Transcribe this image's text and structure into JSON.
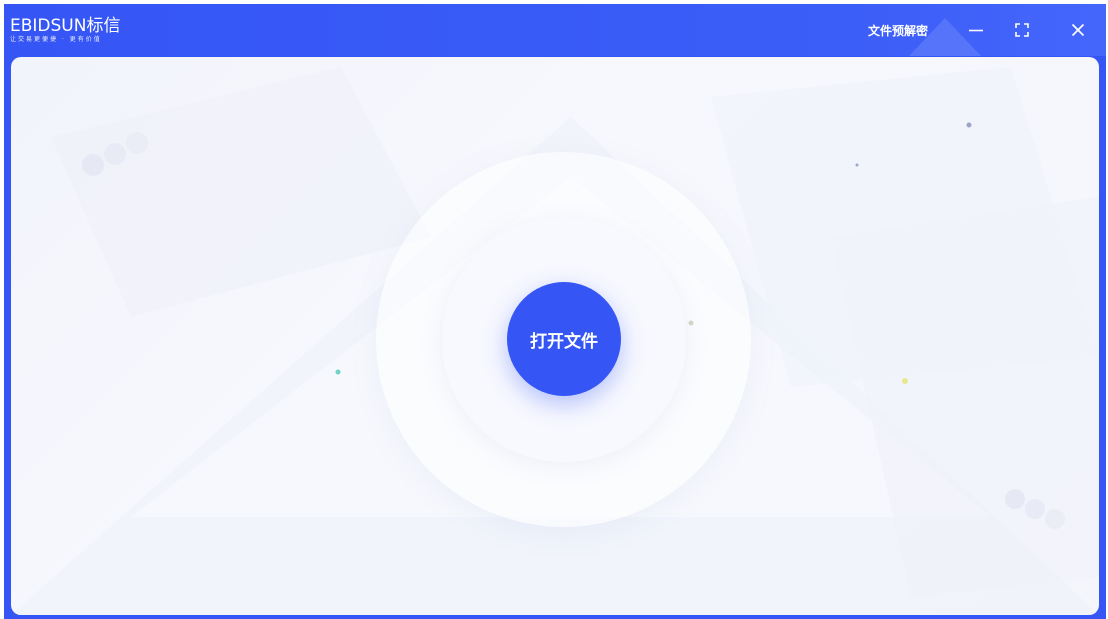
{
  "brand": {
    "name": "EBIDSUN标信",
    "tagline": "让交易更便捷 · 更有价值"
  },
  "titlebar": {
    "app_name": "文件预解密",
    "minimize_icon": "minimize-icon",
    "fullscreen_icon": "fullscreen-icon",
    "close_icon": "close-icon"
  },
  "main": {
    "open_file_label": "打开文件"
  },
  "colors": {
    "accent": "#3556f5",
    "background": "#f4f6fc"
  }
}
